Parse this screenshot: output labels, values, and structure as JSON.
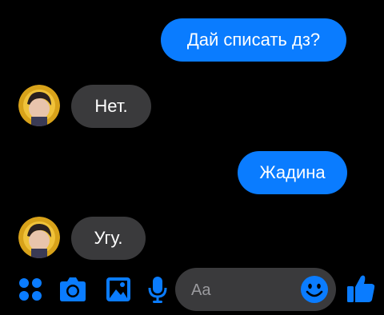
{
  "messages": [
    {
      "direction": "outgoing",
      "text": "Дай списать дз?"
    },
    {
      "direction": "incoming",
      "text": "Нет."
    },
    {
      "direction": "outgoing",
      "text": "Жадина"
    },
    {
      "direction": "incoming",
      "text": "Угу."
    }
  ],
  "composer": {
    "placeholder": "Aa"
  },
  "toolbar": {
    "icons": [
      "apps-icon",
      "camera-icon",
      "gallery-icon",
      "microphone-icon",
      "emoji-icon",
      "like-icon"
    ]
  },
  "colors": {
    "accent": "#0a7cff",
    "incoming_bubble": "#3a3a3c",
    "background": "#000000"
  }
}
